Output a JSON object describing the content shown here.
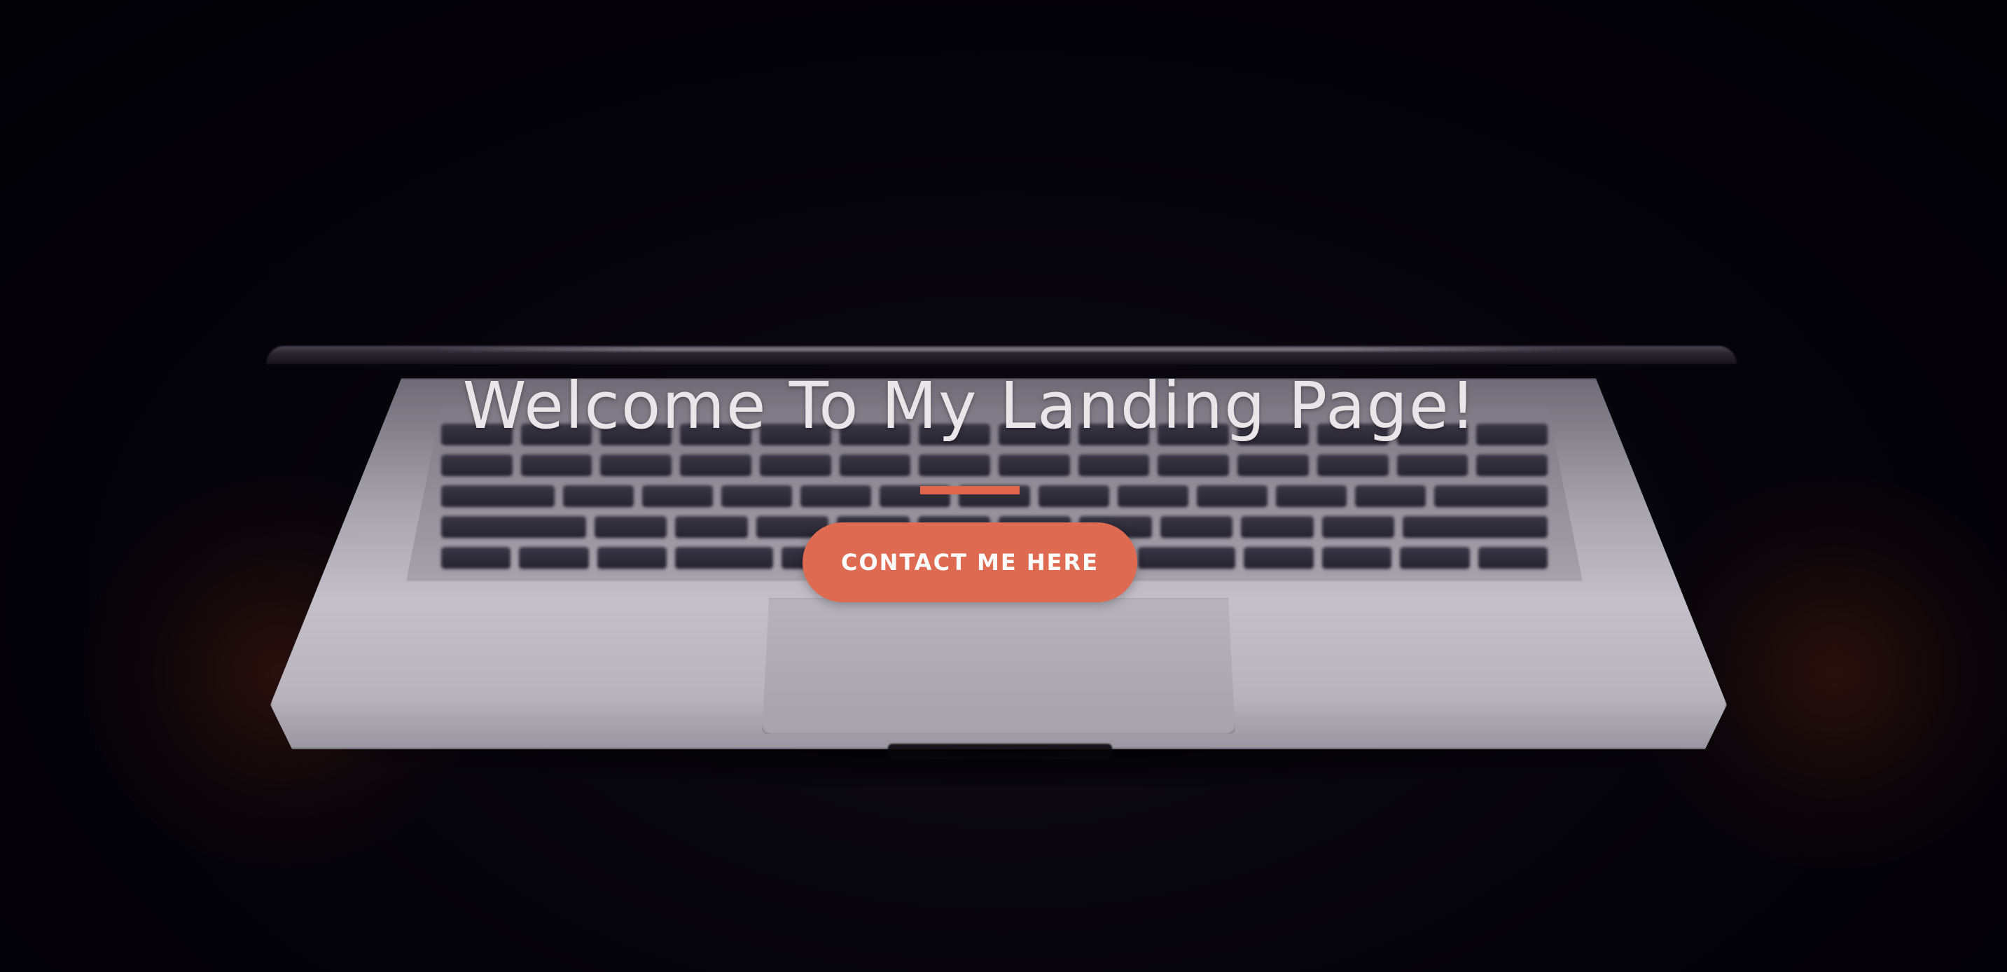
{
  "hero": {
    "title": "Welcome To My Landing Page!",
    "cta_label": "CONTACT ME HERE"
  },
  "colors": {
    "background": "#030208",
    "title_text": "#e9e6ea",
    "accent": "#df6a52",
    "divider": "#e0654a",
    "button_text": "#ffffff"
  },
  "background_image": {
    "subject": "laptop-keyboard-in-dark"
  }
}
